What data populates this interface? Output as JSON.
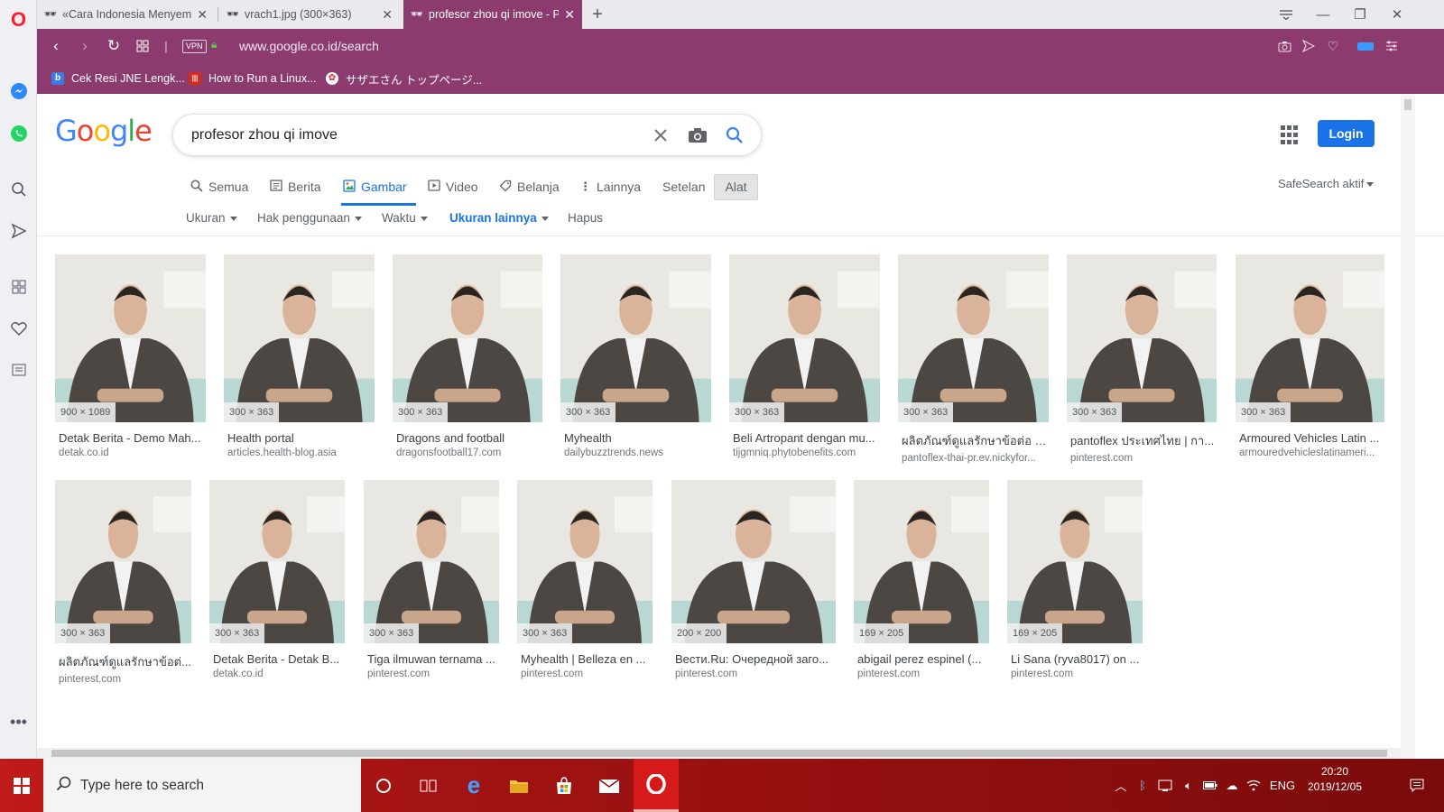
{
  "browser": {
    "tabs": [
      {
        "title": "«Cara Indonesia Menyembu",
        "icon": "incognito-icon",
        "active": false
      },
      {
        "title": "vrach1.jpg (300×363)",
        "icon": "incognito-icon",
        "active": false
      },
      {
        "title": "profesor zhou qi imove - Pe",
        "icon": "incognito-icon",
        "active": true
      }
    ],
    "new_tab_label": "+",
    "vpn_label": "VPN",
    "url": "www.google.co.id/search",
    "bookmarks": [
      {
        "label": "Cek Resi JNE Lengk...",
        "icon_letter": "b",
        "color": "#3d7be0"
      },
      {
        "label": "How to Run a Linux...",
        "icon_letter": "|||",
        "color": "#d62a1d"
      },
      {
        "label": "サザエさん トップページ...",
        "icon_letter": "✿",
        "color": "#ffffff"
      }
    ]
  },
  "google": {
    "logo_letters": [
      {
        "ch": "G",
        "color": "#4285F4"
      },
      {
        "ch": "o",
        "color": "#EA4335"
      },
      {
        "ch": "o",
        "color": "#FBBC05"
      },
      {
        "ch": "g",
        "color": "#4285F4"
      },
      {
        "ch": "l",
        "color": "#34A853"
      },
      {
        "ch": "e",
        "color": "#EA4335"
      }
    ],
    "query": "profesor zhou qi imove",
    "login_label": "Login",
    "tabs": [
      {
        "label": "Semua",
        "icon": "search-icon",
        "glyph": "🔍︎"
      },
      {
        "label": "Berita",
        "icon": "news-icon",
        "glyph": "▤"
      },
      {
        "label": "Gambar",
        "icon": "image-icon",
        "glyph": "▨"
      },
      {
        "label": "Video",
        "icon": "video-icon",
        "glyph": "▶"
      },
      {
        "label": "Belanja",
        "icon": "tag-icon",
        "glyph": "⌂"
      },
      {
        "label": "Lainnya",
        "icon": "more-vert-icon",
        "glyph": "⋮"
      }
    ],
    "settings_label": "Setelan",
    "tools_label": "Alat",
    "safesearch_label": "SafeSearch aktif",
    "filters": [
      "Ukuran",
      "Hak penggunaan",
      "Waktu",
      "Ukuran lainnya",
      "Hapus"
    ]
  },
  "results": [
    {
      "dims": "900 × 1089",
      "title": "Detak Berita - Demo Mah...",
      "source": "detak.co.id"
    },
    {
      "dims": "300 × 363",
      "title": "Health portal",
      "source": "articles.health-blog.asia"
    },
    {
      "dims": "300 × 363",
      "title": "Dragons and football",
      "source": "dragonsfootball17.com"
    },
    {
      "dims": "300 × 363",
      "title": "Myhealth",
      "source": "dailybuzztrends.news"
    },
    {
      "dims": "300 × 363",
      "title": "Beli Artropant dengan mu...",
      "source": "tijgmniq.phytobenefits.com"
    },
    {
      "dims": "300 × 363",
      "title": "ผลิตภัณฑ์ดูแลรักษาข้อต่อ P...",
      "source": "pantoflex-thai-pr.ev.nickyfor..."
    },
    {
      "dims": "300 × 363",
      "title": "pantoflex ประเทศไทย | กา...",
      "source": "pinterest.com"
    },
    {
      "dims": "300 × 363",
      "title": "Armoured Vehicles Latin ...",
      "source": "armouredvehicleslatinameri..."
    },
    {
      "dims": "300 × 363",
      "title": "ผลิตภัณฑ์ดูแลรักษาข้อต่...",
      "source": "pinterest.com"
    },
    {
      "dims": "300 × 363",
      "title": "Detak Berita - Detak B...",
      "source": "detak.co.id"
    },
    {
      "dims": "300 × 363",
      "title": "Tiga ilmuwan ternama ...",
      "source": "pinterest.com"
    },
    {
      "dims": "300 × 363",
      "title": "Myhealth | Belleza en ...",
      "source": "pinterest.com"
    },
    {
      "dims": "200 × 200",
      "title": "Вести.Ru: Очередной заго...",
      "source": "pinterest.com"
    },
    {
      "dims": "169 × 205",
      "title": "abigail perez espinel (...",
      "source": "pinterest.com"
    },
    {
      "dims": "169 × 205",
      "title": "Li Sana (ryva8017) on ...",
      "source": "pinterest.com"
    }
  ],
  "taskbar": {
    "search_placeholder": "Type here to search",
    "language": "ENG",
    "time": "20:20",
    "date": "2019/12/05"
  },
  "colors": {
    "opera_accent": "#8c3b6e",
    "google_blue": "#1a73e8",
    "taskbar_red": "#b01515"
  }
}
